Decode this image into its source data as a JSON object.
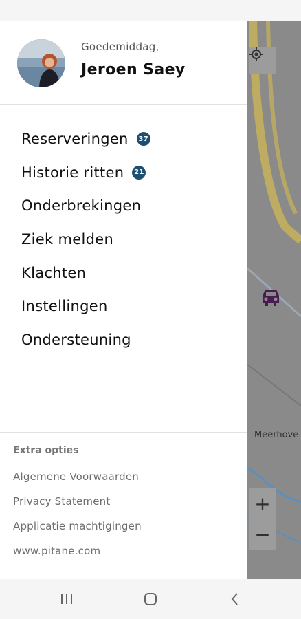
{
  "header": {
    "greeting": "Goedemiddag,",
    "user_name": "Jeroen Saey"
  },
  "menu": [
    {
      "label": "Reserveringen",
      "badge": "37"
    },
    {
      "label": "Historie ritten",
      "badge": "21"
    },
    {
      "label": "Onderbrekingen"
    },
    {
      "label": "Ziek melden"
    },
    {
      "label": "Klachten"
    },
    {
      "label": "Instellingen"
    },
    {
      "label": "Ondersteuning"
    }
  ],
  "footer": {
    "title": "Extra opties",
    "links": [
      "Algemene Voorwaarden",
      "Privacy Statement",
      "Applicatie machtigingen",
      "www.pitane.com"
    ]
  },
  "map": {
    "place_label": "Meerhove",
    "zoom_in": "+",
    "zoom_out": "−",
    "car_color": "#4a1a52"
  },
  "icons": [
    "locate-icon",
    "car-icon",
    "recent-apps-icon",
    "home-icon",
    "back-icon"
  ],
  "colors": {
    "badge": "#1d4f73",
    "road": "#c9b458"
  }
}
